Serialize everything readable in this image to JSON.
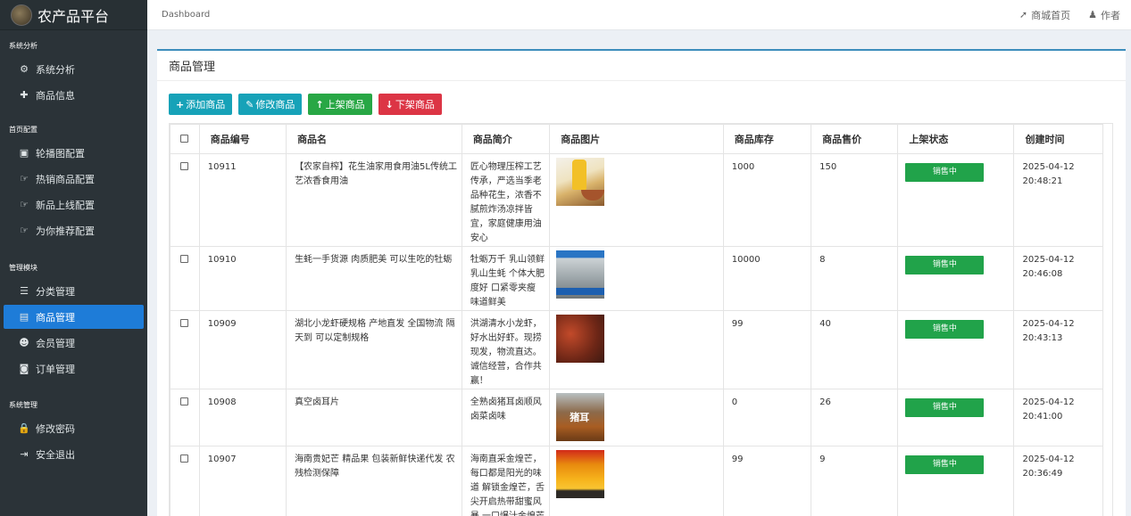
{
  "brand": {
    "title": "农产品平台"
  },
  "sidebar": {
    "sections": [
      {
        "title": "系统分析",
        "items": [
          {
            "icon": "dashboard-icon",
            "glyph": "⚙",
            "label": "系统分析"
          },
          {
            "icon": "plus-icon",
            "glyph": "✚",
            "label": "商品信息"
          }
        ]
      },
      {
        "title": "首页配置",
        "items": [
          {
            "icon": "image-icon",
            "glyph": "▣",
            "label": "轮播图配置"
          },
          {
            "icon": "hand-icon",
            "glyph": "☞",
            "label": "热销商品配置"
          },
          {
            "icon": "hand-icon",
            "glyph": "☞",
            "label": "新品上线配置"
          },
          {
            "icon": "hand-icon",
            "glyph": "☞",
            "label": "为你推荐配置"
          }
        ]
      },
      {
        "title": "管理模块",
        "items": [
          {
            "icon": "list-icon",
            "glyph": "☰",
            "label": "分类管理"
          },
          {
            "icon": "box-icon",
            "glyph": "▤",
            "label": "商品管理",
            "active": true
          },
          {
            "icon": "users-icon",
            "glyph": "☻",
            "label": "会员管理"
          },
          {
            "icon": "money-icon",
            "glyph": "◙",
            "label": "订单管理"
          }
        ]
      },
      {
        "title": "系统管理",
        "items": [
          {
            "icon": "lock-icon",
            "glyph": "🔒",
            "label": "修改密码"
          },
          {
            "icon": "logout-icon",
            "glyph": "⇥",
            "label": "安全退出"
          }
        ]
      }
    ]
  },
  "topbar": {
    "breadcrumb": "Dashboard",
    "links": [
      {
        "icon": "send-icon",
        "glyph": "➚",
        "label": "商城首页"
      },
      {
        "icon": "user-icon",
        "glyph": "♟",
        "label": "作者"
      }
    ]
  },
  "card": {
    "title": "商品管理"
  },
  "toolbar": {
    "add": "添加商品",
    "edit": "修改商品",
    "up": "上架商品",
    "down": "下架商品"
  },
  "table": {
    "headers": [
      "商品编号",
      "商品名",
      "商品简介",
      "商品图片",
      "商品库存",
      "商品售价",
      "上架状态",
      "创建时间"
    ],
    "rows": [
      {
        "id": "10911",
        "name": "【农家自榨】花生油家用食用油5L传统工艺浓香食用油",
        "desc": "匠心物理压榨工艺传承，严选当季老品种花生，浓香不腻煎炸汤凉拌皆宜，家庭健康用油安心",
        "img": "img-oil",
        "stock": "1000",
        "price": "150",
        "status": "销售中",
        "date": "2025-04-12",
        "time": "20:48:21"
      },
      {
        "id": "10910",
        "name": "生蚝一手货源 肉质肥美 可以生吃的牡蛎",
        "desc": "牡蛎万千 乳山领鲜 乳山生蚝 个体大肥度好 口紧零夹瘦 味道鲜美",
        "img": "img-oyster",
        "stock": "10000",
        "price": "8",
        "status": "销售中",
        "date": "2025-04-12",
        "time": "20:46:08"
      },
      {
        "id": "10909",
        "name": "湖北小龙虾硬规格 产地直发 全国物流 隔天到 可以定制规格",
        "desc": "洪湖清水小龙虾，好水出好虾。现捞现发，物流直达。诚信经营，合作共赢！",
        "img": "img-shrimp",
        "stock": "99",
        "price": "40",
        "status": "销售中",
        "date": "2025-04-12",
        "time": "20:43:13"
      },
      {
        "id": "10908",
        "name": "真空卤耳片",
        "desc": "全熟卤猪耳卤顺风卤菜卤味",
        "img": "img-ear",
        "stock": "0",
        "price": "26",
        "status": "销售中",
        "date": "2025-04-12",
        "time": "20:41:00"
      },
      {
        "id": "10907",
        "name": "海南贵妃芒 精品果 包装新鲜快递代发 农残检测保障",
        "desc": "海南直采金煌芒，每口都是阳光的味道 解锁金煌芒，舌尖开启热带甜蜜风暴 一口爆汁金煌芒",
        "img": "img-mango",
        "stock": "99",
        "price": "9",
        "status": "销售中",
        "date": "2025-04-12",
        "time": "20:36:49"
      }
    ]
  },
  "colors": {
    "sidebar": "#2b3338",
    "active": "#1e7cd8",
    "status": "#21a34a",
    "info": "#17a2b8",
    "danger": "#dc3545"
  }
}
